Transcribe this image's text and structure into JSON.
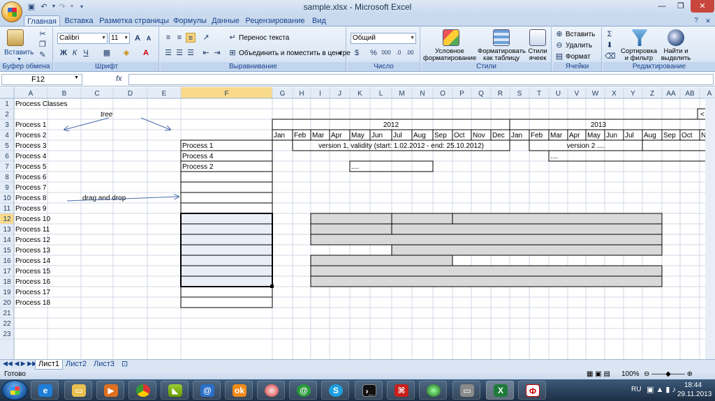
{
  "window": {
    "title": "sample.xlsx - Microsoft Excel"
  },
  "tabs": [
    "Главная",
    "Вставка",
    "Разметка страницы",
    "Формулы",
    "Данные",
    "Рецензирование",
    "Вид"
  ],
  "ribbon": {
    "clipboard": {
      "label": "Буфер обмена",
      "paste": "Вставить"
    },
    "font": {
      "label": "Шрифт",
      "name": "Calibri",
      "size": "11",
      "bold": "Ж",
      "italic": "К",
      "underline": "Ч"
    },
    "alignment": {
      "label": "Выравнивание",
      "wrap": "Перенос текста",
      "merge": "Объединить и поместить в центре"
    },
    "number": {
      "label": "Число",
      "format": "Общий",
      "percent": "%",
      "thousands": "000"
    },
    "styles": {
      "label": "Стили",
      "conditional": "Условное форматирование",
      "as_table": "Форматировать как таблицу",
      "cell_styles": "Стили ячеек"
    },
    "cells": {
      "label": "Ячейки",
      "insert": "Вставить",
      "delete": "Удалить",
      "format": "Формат"
    },
    "editing": {
      "label": "Редактирование",
      "sort": "Сортировка и фильтр",
      "find": "Найти и выделить"
    }
  },
  "formula_bar": {
    "name_box": "F12",
    "fx": "fx",
    "content": ""
  },
  "columns": [
    "A",
    "B",
    "C",
    "D",
    "E",
    "F",
    "G",
    "H",
    "I",
    "J",
    "K",
    "L",
    "M",
    "N",
    "O",
    "P",
    "Q",
    "R",
    "S",
    "T",
    "U",
    "V",
    "W",
    "X",
    "Y",
    "Z",
    "AA",
    "AB",
    "A"
  ],
  "rows": [
    "1",
    "2",
    "3",
    "4",
    "5",
    "6",
    "7",
    "8",
    "9",
    "10",
    "11",
    "12",
    "13",
    "14",
    "15",
    "16",
    "17",
    "18",
    "19",
    "20",
    "21",
    "22",
    "23"
  ],
  "active_cell": "F12",
  "cells": {
    "A1": "Process Classes",
    "D2": "tree",
    "A3": "Process 1",
    "A4": "Process 2",
    "A5": "Process 3",
    "A6": "Process 4",
    "A7": "Process 5",
    "A8": "Process 6",
    "A9": "Process 7",
    "A10": "Process 8",
    "A11": "Process 9",
    "A12": "Process 10",
    "A13": "Process 11",
    "A14": "Process 12",
    "A15": "Process 13",
    "A16": "Process 14",
    "A17": "Process 15",
    "A18": "Process 16",
    "A19": "Process 17",
    "A20": "Process 18",
    "C10": "drag and drop",
    "F5": "Process 1",
    "F6": "Process 4",
    "F7": "Process 2"
  },
  "timeline": {
    "years": [
      "2012",
      "2013"
    ],
    "months": [
      "Jan",
      "Feb",
      "Mar",
      "Apr",
      "May",
      "Jun",
      "Jul",
      "Aug",
      "Sep",
      "Oct",
      "Nov",
      "Dec",
      "Jan",
      "Feb",
      "Mar",
      "Apr",
      "May",
      "Jun",
      "Jul",
      "Aug",
      "Sep",
      "Oct",
      "Nov"
    ],
    "version1": "version 1, validity (start: 1.02.2012 - end: 25.10.2012)",
    "version2": "version 2 ....",
    "dots": "....",
    "scroll_hint": "<"
  },
  "sheets": [
    "Лист1",
    "Лист2",
    "Лист3"
  ],
  "status": {
    "ready": "Готово",
    "zoom": "100%"
  },
  "tray": {
    "lang": "RU",
    "time": "18:44",
    "date": "29.11.2013"
  }
}
